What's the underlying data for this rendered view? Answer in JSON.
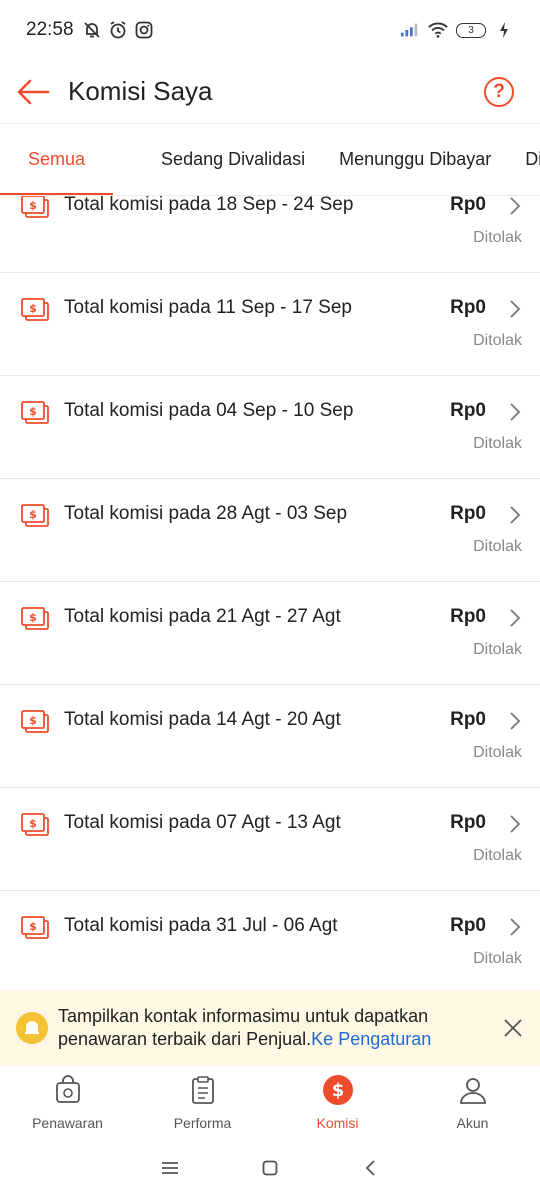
{
  "status_bar": {
    "time": "22:58",
    "icons_left": [
      "bell-off-icon",
      "alarm-icon",
      "instagram-icon"
    ],
    "icons_right": [
      "signal-icon",
      "wifi-icon",
      "battery-icon",
      "charging-icon"
    ],
    "battery_level": "3"
  },
  "header": {
    "title": "Komisi Saya",
    "help_label": "?"
  },
  "tabs": [
    {
      "label": "Semua",
      "active": true
    },
    {
      "label": "Sedang Divalidasi",
      "active": false
    },
    {
      "label": "Menunggu Dibayar",
      "active": false
    },
    {
      "label": "Dib",
      "active": false
    }
  ],
  "commissions": [
    {
      "title": "Total komisi pada 18 Sep - 24 Sep",
      "amount": "Rp0",
      "status": "Ditolak"
    },
    {
      "title": "Total komisi pada 11 Sep - 17 Sep",
      "amount": "Rp0",
      "status": "Ditolak"
    },
    {
      "title": "Total komisi pada 04 Sep - 10 Sep",
      "amount": "Rp0",
      "status": "Ditolak"
    },
    {
      "title": "Total komisi pada 28 Agt - 03 Sep",
      "amount": "Rp0",
      "status": "Ditolak"
    },
    {
      "title": "Total komisi pada 21 Agt - 27 Agt",
      "amount": "Rp0",
      "status": "Ditolak"
    },
    {
      "title": "Total komisi pada 14 Agt - 20 Agt",
      "amount": "Rp0",
      "status": "Ditolak"
    },
    {
      "title": "Total komisi pada 07 Agt - 13 Agt",
      "amount": "Rp0",
      "status": "Ditolak"
    },
    {
      "title": "Total komisi pada 31 Jul - 06 Agt",
      "amount": "Rp0",
      "status": "Ditolak"
    }
  ],
  "banner": {
    "text": "Tampilkan kontak informasimu untuk dapatkan penawaran terbaik dari Penjual.",
    "link": "Ke Pengaturan"
  },
  "bottom_nav": [
    {
      "label": "Penawaran",
      "icon": "offer-bag-icon",
      "active": false
    },
    {
      "label": "Performa",
      "icon": "clipboard-icon",
      "active": false
    },
    {
      "label": "Komisi",
      "icon": "dollar-coin-icon",
      "active": true
    },
    {
      "label": "Akun",
      "icon": "user-icon",
      "active": false
    }
  ],
  "colors": {
    "accent": "#ee4d2d",
    "link": "#1e6bd6",
    "banner_bg": "#fdf7e3",
    "banner_icon": "#f5c235",
    "muted_text": "#888888"
  }
}
